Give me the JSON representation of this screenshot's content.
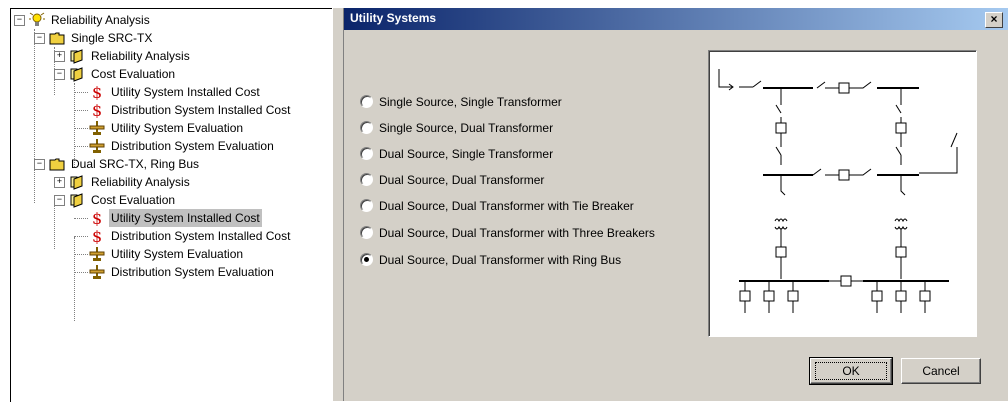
{
  "tree": {
    "items": [
      {
        "label": "Reliability Analysis",
        "icon": "bulb-icon",
        "expander": "−"
      },
      {
        "label": "Single SRC-TX",
        "icon": "folder-icon",
        "expander": "−"
      },
      {
        "label": "Reliability Analysis",
        "icon": "open-folder-icon",
        "expander": "+"
      },
      {
        "label": "Cost Evaluation",
        "icon": "open-folder-icon",
        "expander": "−"
      },
      {
        "label": "Utility System Installed Cost",
        "icon": "dollar-icon"
      },
      {
        "label": "Distribution System Installed Cost",
        "icon": "dollar-icon"
      },
      {
        "label": "Utility System Evaluation",
        "icon": "scale-icon"
      },
      {
        "label": "Distribution System Evaluation",
        "icon": "scale-icon"
      },
      {
        "label": "Dual SRC-TX, Ring Bus",
        "icon": "folder-icon",
        "expander": "−"
      },
      {
        "label": "Reliability Analysis",
        "icon": "open-folder-icon",
        "expander": "+"
      },
      {
        "label": "Cost Evaluation",
        "icon": "open-folder-icon",
        "expander": "−"
      },
      {
        "label": "Utility System Installed Cost",
        "icon": "dollar-icon",
        "selected": true
      },
      {
        "label": "Distribution System Installed Cost",
        "icon": "dollar-icon"
      },
      {
        "label": "Utility System Evaluation",
        "icon": "scale-icon"
      },
      {
        "label": "Distribution System Evaluation",
        "icon": "scale-icon"
      }
    ]
  },
  "dialog": {
    "title": "Utility Systems",
    "close": "×",
    "options": [
      {
        "label": "Single Source, Single Transformer",
        "checked": false
      },
      {
        "label": "Single Source, Dual Transformer",
        "checked": false
      },
      {
        "label": "Dual Source, Single Transformer",
        "checked": false
      },
      {
        "label": "Dual Source, Dual Transformer",
        "checked": false
      },
      {
        "label": "Dual Source, Dual Transformer with Tie Breaker",
        "checked": false
      },
      {
        "label": "Dual Source, Dual Transformer with Three Breakers",
        "checked": false
      },
      {
        "label": "Dual Source, Dual Transformer with Ring Bus",
        "checked": true
      }
    ],
    "ok_label": "OK",
    "cancel_label": "Cancel"
  },
  "colors": {
    "dollar": "#cc0000",
    "folder": "#f0d040",
    "title_start": "#0a246a",
    "title_end": "#a6caf0"
  }
}
